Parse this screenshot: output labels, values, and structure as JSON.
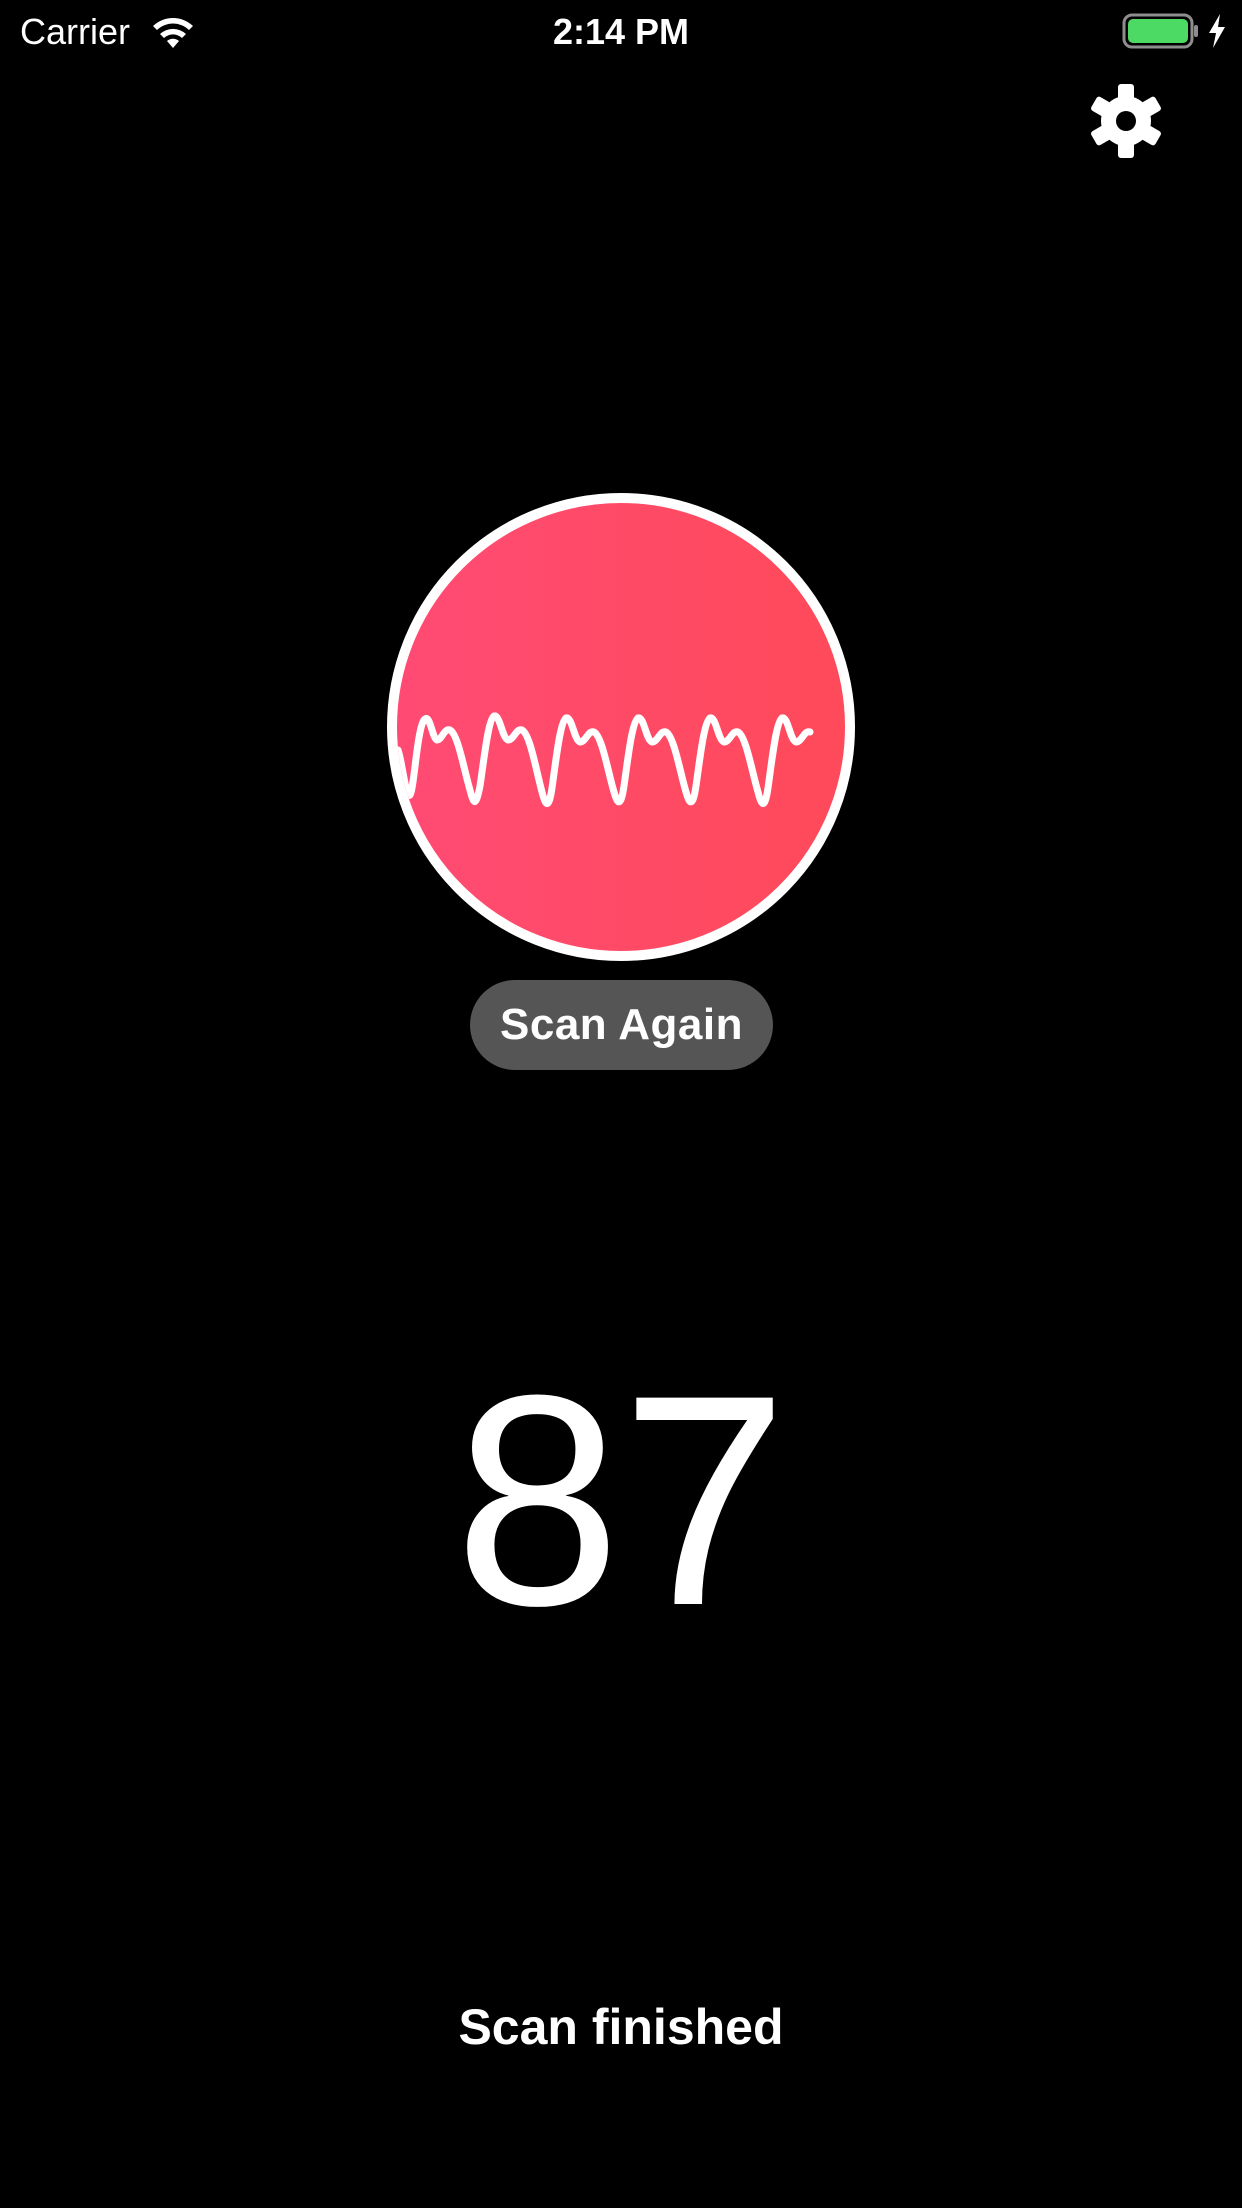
{
  "status_bar": {
    "carrier": "Carrier",
    "time": "2:14 PM",
    "battery_color": "#4cd964"
  },
  "icons": {
    "wifi": "wifi-icon",
    "battery": "battery-icon",
    "charging": "charging-bolt-icon",
    "settings": "gear-icon",
    "waveform": "heartbeat-waveform-icon"
  },
  "scanner": {
    "gradient_start": "#ff4b74",
    "gradient_end": "#ff4a5a",
    "ring_color": "#ffffff",
    "scan_again_label": "Scan Again"
  },
  "result": {
    "bpm": "87",
    "status": "Scan finished"
  }
}
